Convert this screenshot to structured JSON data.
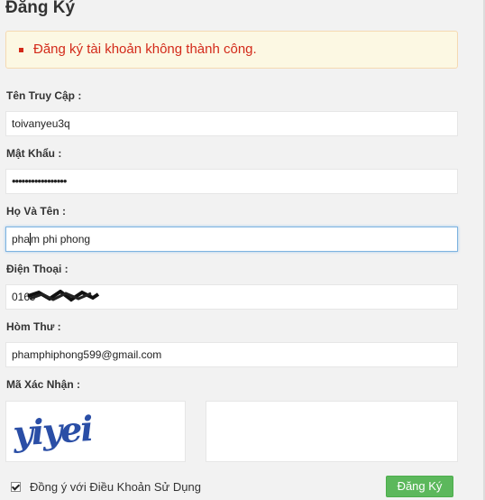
{
  "form": {
    "title": "Đăng Ký",
    "alert_message": "Đăng ký tài khoản không thành công.",
    "alert_color": "#d32a1a",
    "fields": {
      "username": {
        "label": "Tên Truy Cập :",
        "value": "toivanyeu3q"
      },
      "password": {
        "label": "Mật Khẩu :",
        "value": "•••••••••••••••••"
      },
      "fullname": {
        "label": "Họ Và Tên :",
        "value_before_caret": "pha",
        "value_after_caret": "m phi phong"
      },
      "phone": {
        "label": "Điện Thoại :",
        "value": "0169"
      },
      "email": {
        "label": "Hòm Thư :",
        "value": "phamphiphong599@gmail.com"
      }
    },
    "captcha": {
      "label": "Mã Xác Nhận :",
      "image_text": "yiyei"
    },
    "agree_label": "Đồng ý với Điều Khoản Sử Dụng",
    "agree_checked": true,
    "submit_label": "Đăng Ký",
    "submit_color": "#5cb85c"
  }
}
